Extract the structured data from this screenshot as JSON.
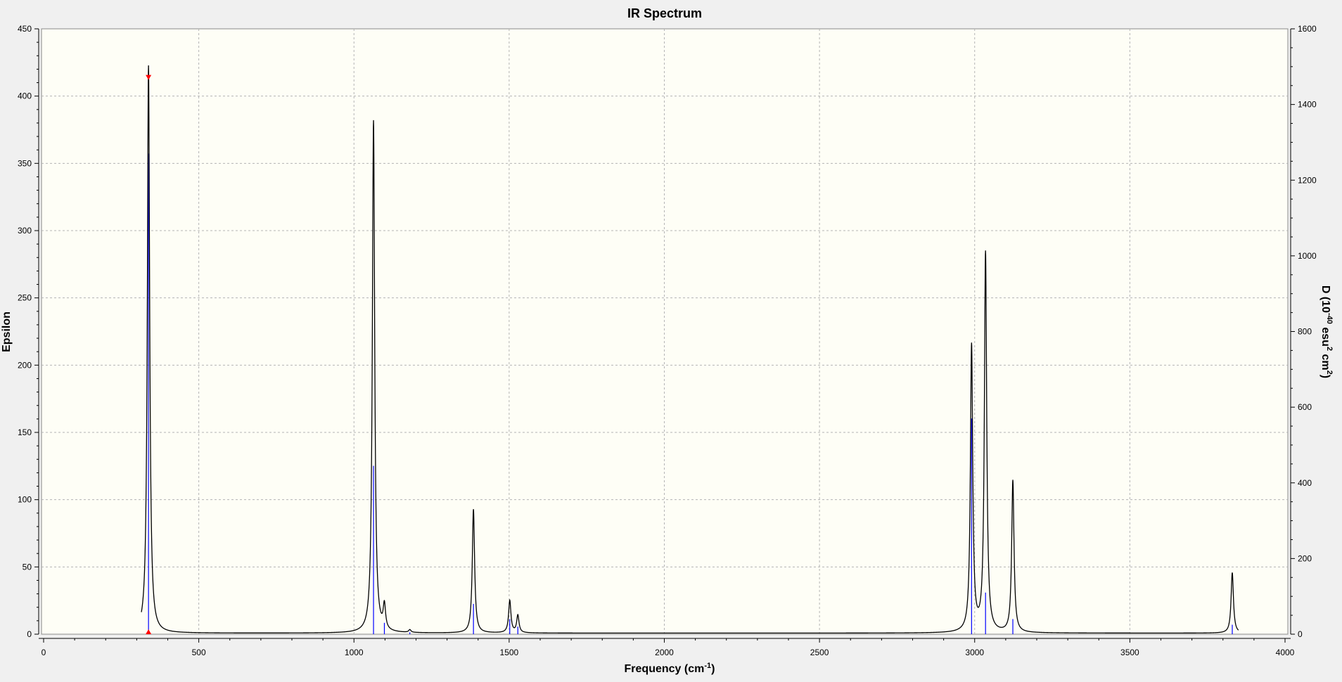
{
  "chart_data": {
    "type": "line",
    "title": "IR Spectrum",
    "xlabel": {
      "main": "Frequency (cm",
      "sup": "-1",
      "tail": ")"
    },
    "ylabel_left": "Epsilon",
    "ylabel_right": {
      "p1": "D (10",
      "s1": "-40",
      "p2": " esu",
      "s2": "2",
      "p3": " cm",
      "s3": "2",
      "p4": ")"
    },
    "xlim": [
      0,
      4000
    ],
    "ylim_left": [
      0,
      450
    ],
    "ylim_right": [
      0,
      1600
    ],
    "x_ticks": [
      0,
      500,
      1000,
      1500,
      2000,
      2500,
      3000,
      3500,
      4000
    ],
    "y_ticks_left": [
      0,
      50,
      100,
      150,
      200,
      250,
      300,
      350,
      400,
      450
    ],
    "y_ticks_right": [
      0,
      200,
      400,
      600,
      800,
      1000,
      1200,
      1400,
      1600
    ],
    "grid": true,
    "spectrum_range": [
      315,
      3850
    ],
    "baseline": 0.8,
    "peaks": [
      {
        "x": 338,
        "epsilon": 422,
        "d": 1270
      },
      {
        "x": 1063,
        "epsilon": 381,
        "d": 445
      },
      {
        "x": 1098,
        "epsilon": 18,
        "d": 30
      },
      {
        "x": 1180,
        "epsilon": 2,
        "d": 5
      },
      {
        "x": 1385,
        "epsilon": 92,
        "d": 80
      },
      {
        "x": 1502,
        "epsilon": 24,
        "d": 40
      },
      {
        "x": 1528,
        "epsilon": 13,
        "d": 20
      },
      {
        "x": 2990,
        "epsilon": 213,
        "d": 570
      },
      {
        "x": 3035,
        "epsilon": 282,
        "d": 110
      },
      {
        "x": 3123,
        "epsilon": 113,
        "d": 40
      },
      {
        "x": 3830,
        "epsilon": 45,
        "d": 25
      }
    ],
    "marker_x": 338,
    "colors": {
      "plot_bg": "#fefef6",
      "line": "#000000",
      "sticks": "#0000ff",
      "marker": "#ff0000",
      "grid": "#b4b4b4"
    }
  }
}
